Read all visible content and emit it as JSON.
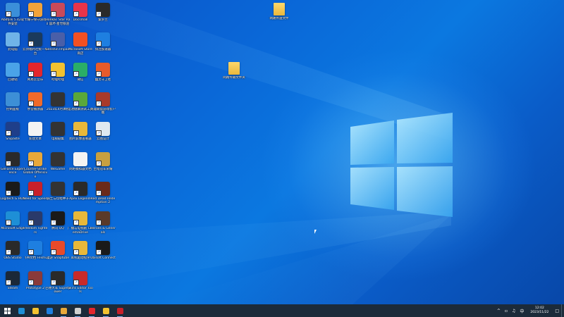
{
  "desktop_icons": [
    {
      "label": "Abdfjsk 5.42软件安装",
      "color": "#3b8fd9",
      "shortcut": true
    },
    {
      "label": "卡婊宁保守游戏",
      "color": "#f2a33a",
      "shortcut": true
    },
    {
      "label": "Honkai: Star Rail 崩坏·星穹铁道",
      "color": "#c94a5a",
      "shortcut": true
    },
    {
      "label": "Docsmall",
      "color": "#e8344a",
      "shortcut": true
    },
    {
      "label": "紫罗兰",
      "color": "#2a2a2a",
      "shortcut": true
    },
    {
      "label": "此电脑",
      "color": "#6fb3e8",
      "shortcut": false
    },
    {
      "label": "云顶福利社统一平台",
      "color": "#1b3a5c",
      "shortcut": true
    },
    {
      "label": "Genshin Impact",
      "color": "#4a5fa8",
      "shortcut": true
    },
    {
      "label": "Microsoft Store 商店",
      "color": "#f25022",
      "shortcut": false
    },
    {
      "label": "快连加速器",
      "color": "#1e7fe0",
      "shortcut": true
    },
    {
      "label": "回收站",
      "color": "#4aa3e8",
      "shortcut": false
    },
    {
      "label": "网易云音乐",
      "color": "#e3262d",
      "shortcut": true
    },
    {
      "label": "哔哩哔哩",
      "color": "#f2c230",
      "shortcut": true
    },
    {
      "label": "微信",
      "color": "#2aae67",
      "shortcut": true
    },
    {
      "label": "幽灵守卫者",
      "color": "#e85b2a",
      "shortcut": true
    },
    {
      "label": "控制面板",
      "color": "#3d8fd6",
      "shortcut": false
    },
    {
      "label": "余音播放器",
      "color": "#f06a2a",
      "shortcut": true
    },
    {
      "label": "2023年4月课程",
      "color": "#333333",
      "shortcut": false
    },
    {
      "label": "电池健康测试工具",
      "color": "#5aa83a",
      "shortcut": true
    },
    {
      "label": "英雄联盟游戏客户端",
      "color": "#a83a2a",
      "shortcut": true
    },
    {
      "label": "Snipaste",
      "color": "#1f3f8a",
      "shortcut": true
    },
    {
      "label": "新建文本",
      "color": "#f3f3f3",
      "shortcut": false
    },
    {
      "label": "电视剧集",
      "color": "#333333",
      "shortcut": false
    },
    {
      "label": "图片影像查看器",
      "color": "#e8b83a",
      "shortcut": true
    },
    {
      "label": "云图设计",
      "color": "#dfe8f0",
      "shortcut": true
    },
    {
      "label": "GeForce Experience",
      "color": "#2a2a2a",
      "shortcut": true
    },
    {
      "label": "Counter-Strike Global Offensive",
      "color": "#e8a83a",
      "shortcut": true
    },
    {
      "label": "WeGame",
      "color": "#333333",
      "shortcut": false
    },
    {
      "label": "网吧模拟器文档",
      "color": "#f3f3f3",
      "shortcut": false
    },
    {
      "label": "至暗冠军荣耀",
      "color": "#c8a040",
      "shortcut": true
    },
    {
      "label": "Logitech G HUB",
      "color": "#1a1a1a",
      "shortcut": true
    },
    {
      "label": "Need for Speed",
      "color": "#c8202a",
      "shortcut": true
    },
    {
      "label": "骑士与俘给种子",
      "color": "#333333",
      "shortcut": false
    },
    {
      "label": "Apex Legends",
      "color": "#2a2a2a",
      "shortcut": true
    },
    {
      "label": "Red Dead Redemption 2",
      "color": "#6a2a1a",
      "shortcut": true
    },
    {
      "label": "Microsoft Edge",
      "color": "#1e8fd6",
      "shortcut": true
    },
    {
      "label": "Freedom Fighters",
      "color": "#2a3a6a",
      "shortcut": true
    },
    {
      "label": "腾讯 QQ",
      "color": "#1a1a1a",
      "shortcut": true
    },
    {
      "label": "广播与电视剧 CinemaDrive",
      "color": "#e8b83a",
      "shortcut": true
    },
    {
      "label": "Heroes & Generals",
      "color": "#5a3a2a",
      "shortcut": true
    },
    {
      "label": "OBS Studio",
      "color": "#2a2a2a",
      "shortcut": true
    },
    {
      "label": "飞书文档 Feishu",
      "color": "#1e7fe0",
      "shortcut": true
    },
    {
      "label": "漫游 Snaptube",
      "color": "#e84a2a",
      "shortcut": true
    },
    {
      "label": "耳机驱动程序",
      "color": "#e8b83a",
      "shortcut": true
    },
    {
      "label": "Ubisoft Connect",
      "color": "#1a1a1a",
      "shortcut": true
    },
    {
      "label": "Steam",
      "color": "#1b2838",
      "shortcut": true
    },
    {
      "label": "Prototype 2",
      "color": "#8a3a3a",
      "shortcut": true
    },
    {
      "label": "巴德大军 Superpower",
      "color": "#2a2a2a",
      "shortcut": true
    },
    {
      "label": "Skins Editor Tools",
      "color": "#c82a2a",
      "shortcut": true
    }
  ],
  "desktop_folders": [
    {
      "label": "网路传送文件"
    },
    {
      "label": "网路传输文件夹"
    }
  ],
  "taskbar": {
    "start_icon": "windows-start-icon",
    "pinned": [
      {
        "name": "edge",
        "color": "#1e8fd6"
      },
      {
        "name": "file-explorer",
        "color": "#f2c230"
      },
      {
        "name": "feishu",
        "color": "#1e7fe0"
      },
      {
        "name": "manager",
        "color": "#e8a83a"
      },
      {
        "name": "clock-app",
        "color": "#d0d0d0"
      },
      {
        "name": "netease-music",
        "color": "#e3262d"
      },
      {
        "name": "bilibili",
        "color": "#f2c230"
      },
      {
        "name": "game-app",
        "color": "#c8202a"
      }
    ],
    "tray": {
      "chevron": "^",
      "ime": "中",
      "time": "12:02",
      "date": "2023/11/22"
    }
  }
}
